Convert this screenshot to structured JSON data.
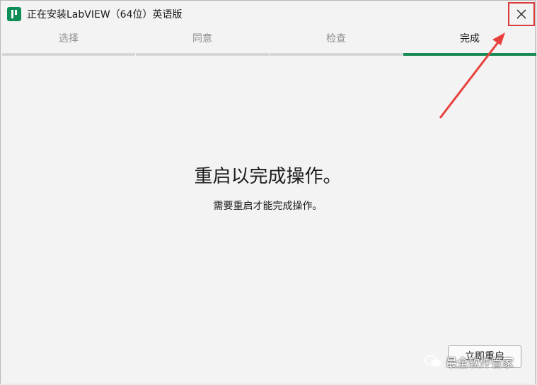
{
  "window": {
    "title": "正在安装LabVIEW（64位）英语版",
    "close_icon": "close-icon"
  },
  "tabs": [
    {
      "label": "选择",
      "active": false
    },
    {
      "label": "同意",
      "active": false
    },
    {
      "label": "检查",
      "active": false
    },
    {
      "label": "完成",
      "active": true
    }
  ],
  "main": {
    "headline": "重启以完成操作。",
    "subtext": "需要重启才能完成操作。",
    "restart_button": "立即重启"
  },
  "watermark": {
    "text": "最全软件管家",
    "icon": "wechat-icon"
  },
  "colors": {
    "accent": "#1a8a57",
    "highlight": "#d93b3b"
  }
}
